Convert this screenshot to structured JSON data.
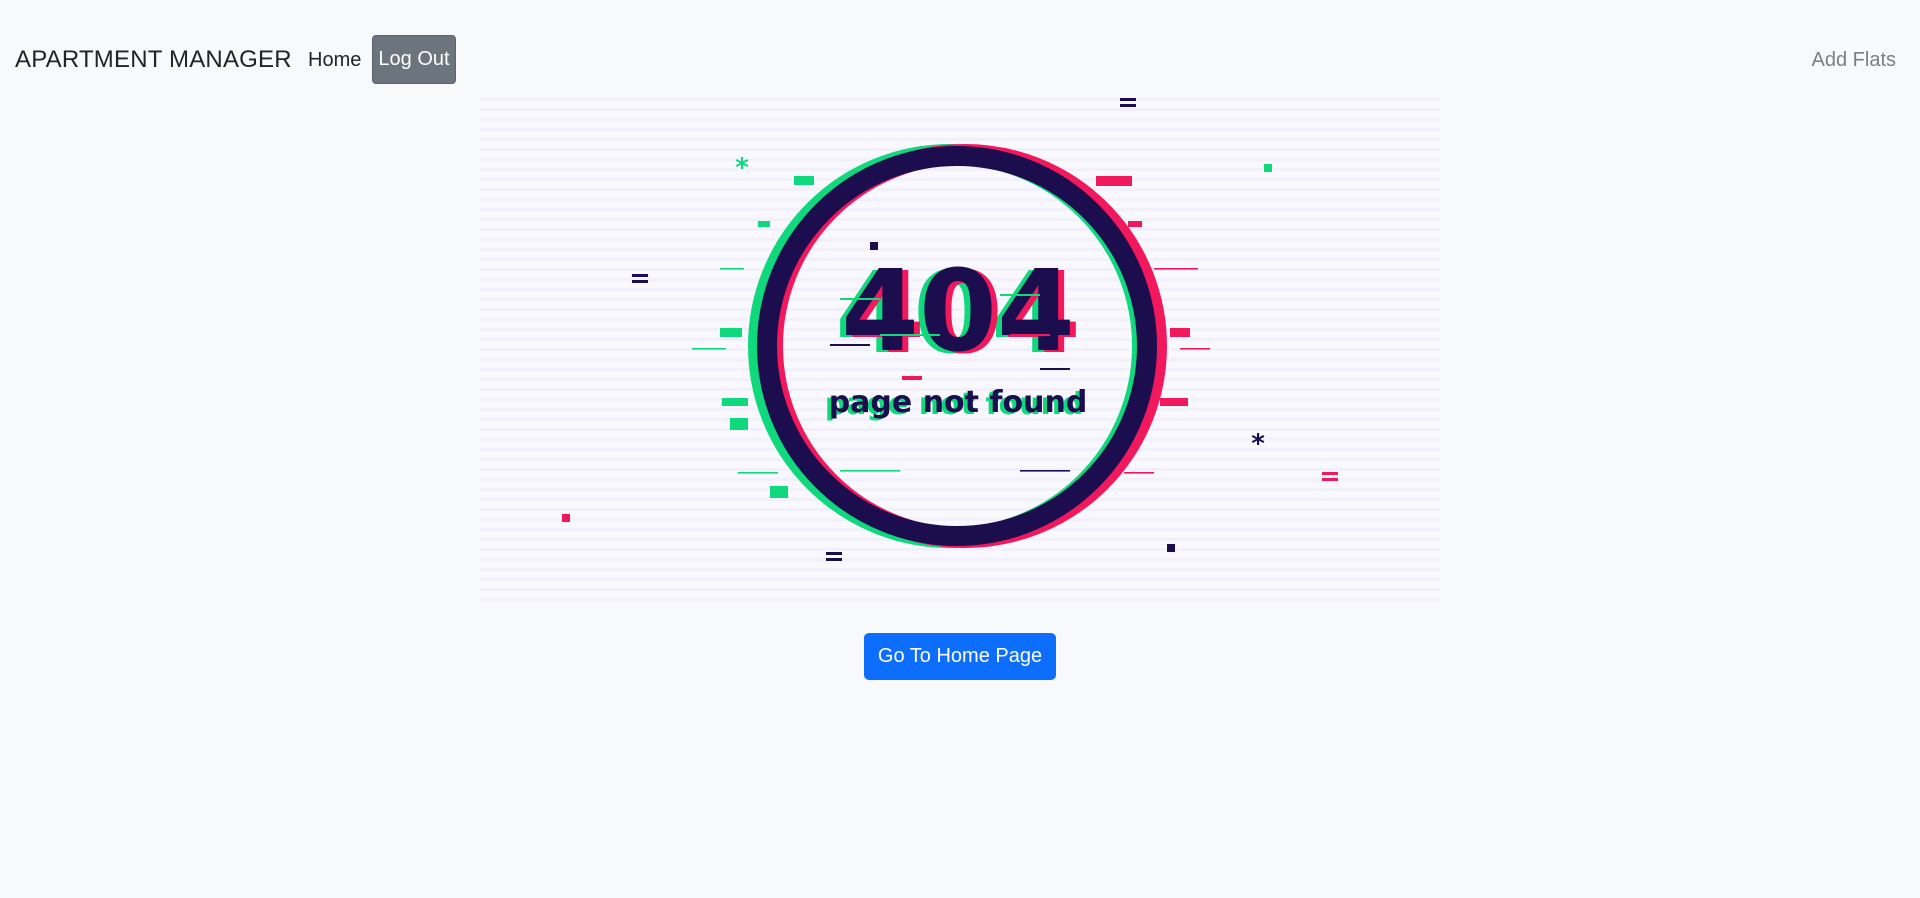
{
  "navbar": {
    "brand": "APARTMENT MANAGER",
    "home_label": "Home",
    "logout_label": "Log Out",
    "add_flats_label": "Add Flats"
  },
  "illustration": {
    "code": "404",
    "message": "page not found",
    "colors": {
      "navy": "#1c0d4f",
      "magenta": "#f2185c",
      "green": "#10d87d"
    }
  },
  "actions": {
    "home_button_label": "Go To Home Page"
  },
  "colors": {
    "primary": "#0d6efd",
    "secondary": "#6c757d",
    "background": "#f8f9fa"
  }
}
